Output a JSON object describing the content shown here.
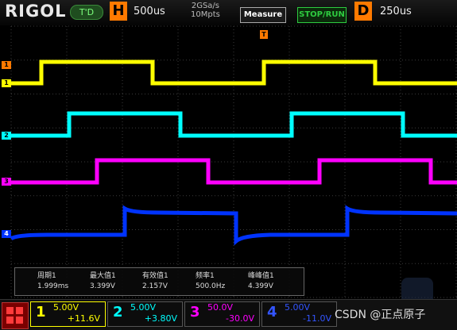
{
  "header": {
    "logo": "RIGOL",
    "trigger_status": "T'D",
    "horizontal_label": "H",
    "timebase": "500us",
    "sample_rate": "2GSa/s",
    "memory_depth": "10Mpts",
    "measure_label": "Measure",
    "stop_run_label": "STOP/RUN",
    "delay_label": "D",
    "delay": "250us"
  },
  "trigger_marker": "T",
  "channels_markers": [
    "1",
    "2",
    "3",
    "4"
  ],
  "measurements": [
    {
      "name": "周期1",
      "value": "1.999ms"
    },
    {
      "name": "最大值1",
      "value": "3.399V"
    },
    {
      "name": "有效值1",
      "value": "2.157V"
    },
    {
      "name": "频率1",
      "value": "500.0Hz"
    },
    {
      "name": "峰峰值1",
      "value": "4.399V"
    }
  ],
  "channels": [
    {
      "num": "1",
      "volts_div": "5.00V",
      "offset": "+11.6V",
      "color": "#ffff00"
    },
    {
      "num": "2",
      "volts_div": "5.00V",
      "offset": "+3.80V",
      "color": "#00ffff"
    },
    {
      "num": "3",
      "volts_div": "50.0V",
      "offset": "-30.0V",
      "color": "#ff00ff"
    },
    {
      "num": "4",
      "volts_div": "5.00V",
      "offset": "-11.0V",
      "color": "#0033ff"
    }
  ],
  "trace_colors": {
    "ch1": "#ffff00",
    "ch2": "#00ffff",
    "ch3": "#ff00ff",
    "ch4": "#0033ff"
  },
  "watermark": "CSDN @正点原子"
}
